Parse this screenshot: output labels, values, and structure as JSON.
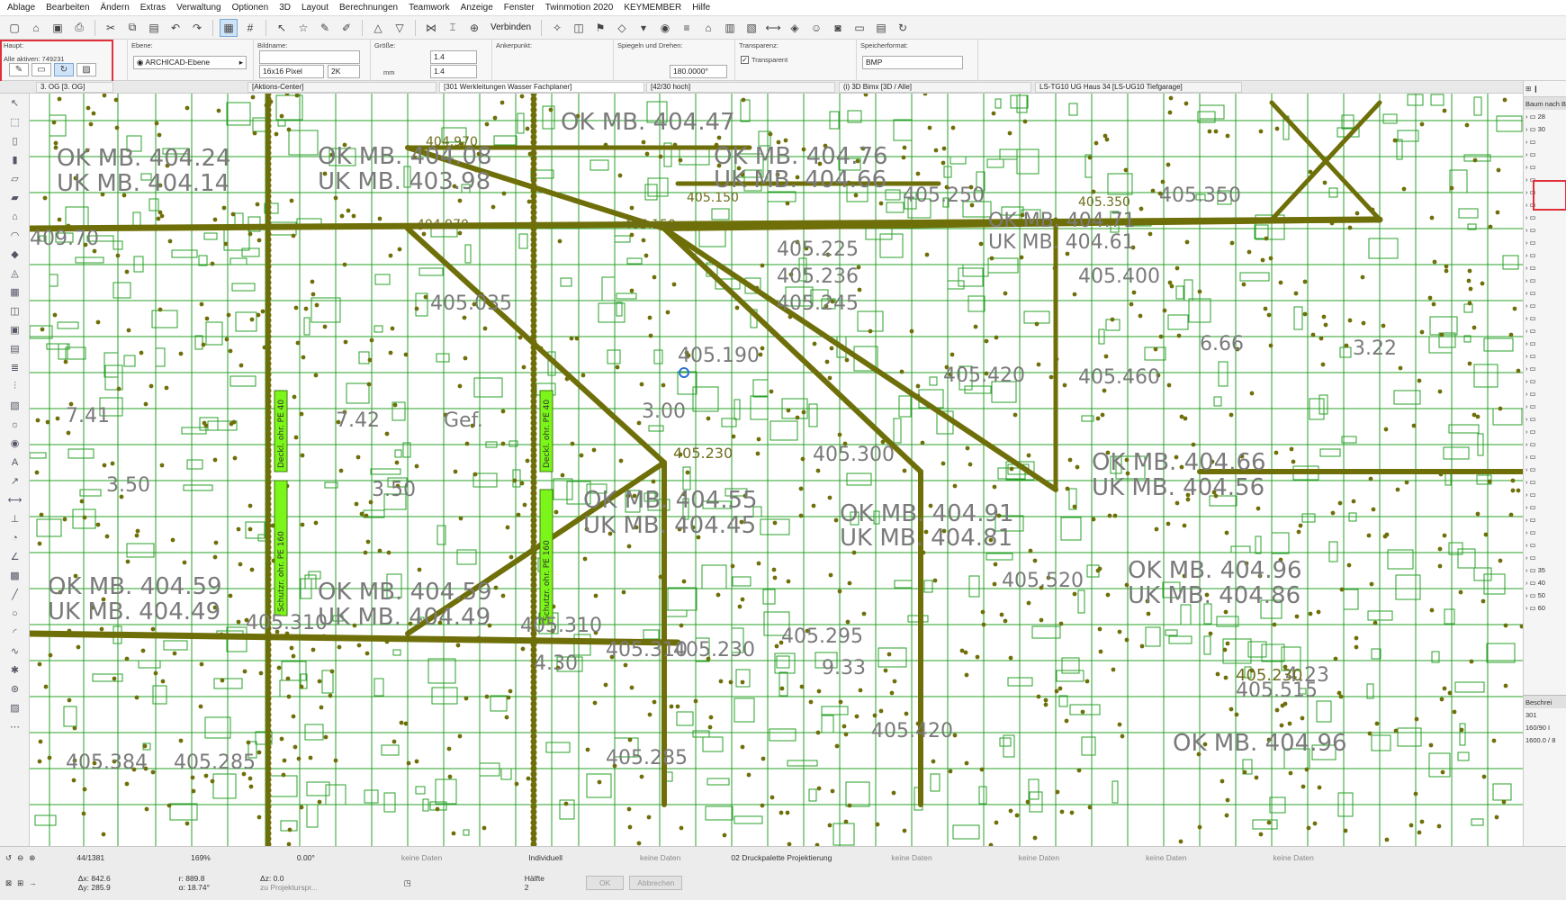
{
  "menu": [
    "Ablage",
    "Bearbeiten",
    "Ändern",
    "Extras",
    "Verwaltung",
    "Optionen",
    "3D",
    "Layout",
    "Berechnungen",
    "Teamwork",
    "Anzeige",
    "Fenster",
    "Twinmotion 2020",
    "KEYMEMBER",
    "Hilfe"
  ],
  "toolbar": {
    "connect_label": "Verbinden"
  },
  "infobox": {
    "haupt_label": "Haupt:",
    "alle_aktiven": "Alle aktiven: 749231",
    "ebene_label": "Ebene:",
    "ebene_value": "ARCHICAD-Ebene",
    "bildname_label": "Bildname:",
    "bildname_value": "",
    "pixel_value": "16x16 Pixel",
    "k_value": "2K",
    "groesse_label": "Größe:",
    "size_a": "1.4",
    "size_b": "1.4",
    "unit_mm": "mm",
    "anker_label": "Ankerpunkt:",
    "spiegeln_label": "Spiegeln und Drehen:",
    "angle_value": "180.0000°",
    "transparenz_label": "Transparenz:",
    "transparent_label": "Transparent",
    "format_label": "Speicherformat:",
    "format_value": "BMP"
  },
  "tabs": [
    "3. OG [3. OG]",
    "[Aktions-Center]",
    "[301 Werkleitungen Wasser Fachplaner]",
    "[42/30 hoch]",
    "(i) 3D Bimx [3D / Alle]",
    "LS-TG10 UG Haus 34 [LS-UG10 Tiefgarage]"
  ],
  "navigator": {
    "header": "Baum nach B",
    "items": [
      "28",
      "30",
      "",
      "",
      "",
      "",
      "",
      "",
      "",
      "",
      "",
      "",
      "",
      "",
      "",
      "",
      "",
      "",
      "",
      "",
      "",
      "",
      "",
      "",
      "",
      "",
      "",
      "",
      "",
      "",
      "",
      "",
      "",
      "",
      "",
      "",
      "35",
      "40",
      "50",
      "60"
    ],
    "bottom_title": "Beschrei",
    "bottom_values": [
      "301",
      "160/90 I",
      "1600.0 / 8"
    ]
  },
  "canvas": {
    "labels": [
      {
        "t": "OK MB. 404.24"
      },
      {
        "t": "UK MB. 404.14"
      },
      {
        "t": "OK MB. 404.08"
      },
      {
        "t": "UK MB. 403.98"
      },
      {
        "t": "404.970"
      },
      {
        "t": "404.970"
      },
      {
        "t": "409.70"
      },
      {
        "t": "OK MB. 404.47"
      },
      {
        "t": "OK MB. 404.76"
      },
      {
        "t": "UK MB. 404.66"
      },
      {
        "t": "405.150"
      },
      {
        "t": "405.150"
      },
      {
        "t": "405.250"
      },
      {
        "t": "405.350"
      },
      {
        "t": "405.350"
      },
      {
        "t": "OK MB. 404.71"
      },
      {
        "t": "UK MB. 404.61"
      },
      {
        "t": "405.225"
      },
      {
        "t": "405.236"
      },
      {
        "t": "405.245"
      },
      {
        "t": "405.400"
      },
      {
        "t": "405.035"
      },
      {
        "t": "405.190"
      },
      {
        "t": "6.66"
      },
      {
        "t": "3.22"
      },
      {
        "t": "405.420"
      },
      {
        "t": "405.460"
      },
      {
        "t": "7.41"
      },
      {
        "t": "7.42"
      },
      {
        "t": "Gef."
      },
      {
        "t": "3.00"
      },
      {
        "t": "405.230"
      },
      {
        "t": "405.300"
      },
      {
        "t": "OK MB. 404.66"
      },
      {
        "t": "UK MB. 404.56"
      },
      {
        "t": "3.50"
      },
      {
        "t": "3.50"
      },
      {
        "t": "OK MB. 404.55"
      },
      {
        "t": "UK MB. 404.45"
      },
      {
        "t": "OK MB. 404.91"
      },
      {
        "t": "UK MB. 404.81"
      },
      {
        "t": "OK MB. 404.59"
      },
      {
        "t": "UK MB. 404.49"
      },
      {
        "t": "OK MB. 404.59"
      },
      {
        "t": "UK MB. 404.49"
      },
      {
        "t": "405.520"
      },
      {
        "t": "OK MB. 404.96"
      },
      {
        "t": "UK MB. 404.86"
      },
      {
        "t": "405.310"
      },
      {
        "t": "405.310"
      },
      {
        "t": "405.295"
      },
      {
        "t": "405.230"
      },
      {
        "t": "4.30"
      },
      {
        "t": "9.33"
      },
      {
        "t": "4.23"
      },
      {
        "t": "405.310"
      },
      {
        "t": "405.515"
      },
      {
        "t": "405.230"
      },
      {
        "t": "405.420"
      },
      {
        "t": "405.285"
      },
      {
        "t": "405.384"
      },
      {
        "t": "405.285"
      },
      {
        "t": "OK MB. 404.96"
      }
    ],
    "badges": [
      "Deckl. ohr. PE 40",
      "Schutzr. ohr. PE 160",
      "Deckl. ohr. PE 40",
      "Schutzr. ohr. PE 160"
    ]
  },
  "status": {
    "page": "44/1381",
    "zoom": "169%",
    "angle": "0.00°",
    "keine_daten": "keine Daten",
    "individuell": "Individuell",
    "druckpalette": "02 Druckpalette Projektierung",
    "dx": "Δx: 842.6",
    "dy": "Δy: 285.9",
    "r": "r: 889.8",
    "a": "α: 18.74°",
    "dz": "Δz: 0.0",
    "projekt": "zu Projekturspr...",
    "haelfte": "Hälfte",
    "haelfte_num": "2",
    "ok": "OK",
    "abbrechen": "Abbrechen"
  },
  "colors": {
    "pipe": "#6f6f0a",
    "grid": "#2aa12a",
    "badge": "#7cf51a",
    "highlight": "#e0303a"
  }
}
